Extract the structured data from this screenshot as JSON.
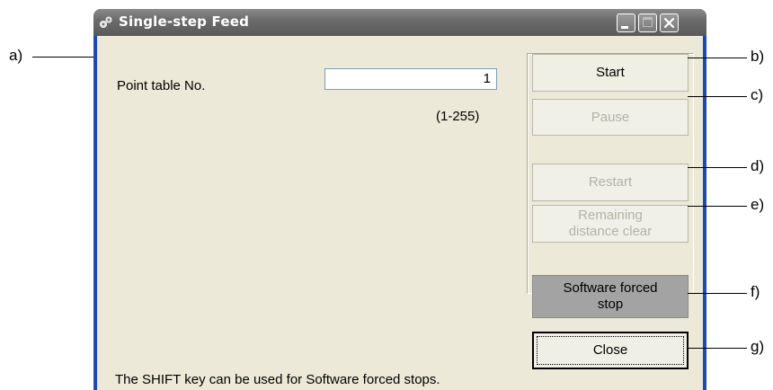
{
  "window": {
    "title": "Single-step Feed",
    "icon": "app-gear-icon"
  },
  "title_buttons": {
    "minimize": "minimize-icon",
    "maximize": "maximize-icon",
    "close": "close-icon"
  },
  "form": {
    "point_table_label": "Point table No.",
    "point_table_value": "1",
    "range_text": "(1-255)",
    "hint": "The SHIFT key can be used for Software forced stops."
  },
  "buttons": {
    "start": "Start",
    "pause": "Pause",
    "restart": "Restart",
    "remaining_line1": "Remaining",
    "remaining_line2": "distance clear",
    "forced_line1": "Software forced",
    "forced_line2": "stop",
    "close": "Close"
  },
  "annotations": {
    "a": "a)",
    "b": "b)",
    "c": "c)",
    "d": "d)",
    "e": "e)",
    "f": "f)",
    "g": "g)"
  },
  "colors": {
    "titlebar": "#6c6c6c",
    "client": "#ece9d8",
    "forced_button": "#a3a3a3",
    "disabled_text": "#b4b2a4"
  }
}
